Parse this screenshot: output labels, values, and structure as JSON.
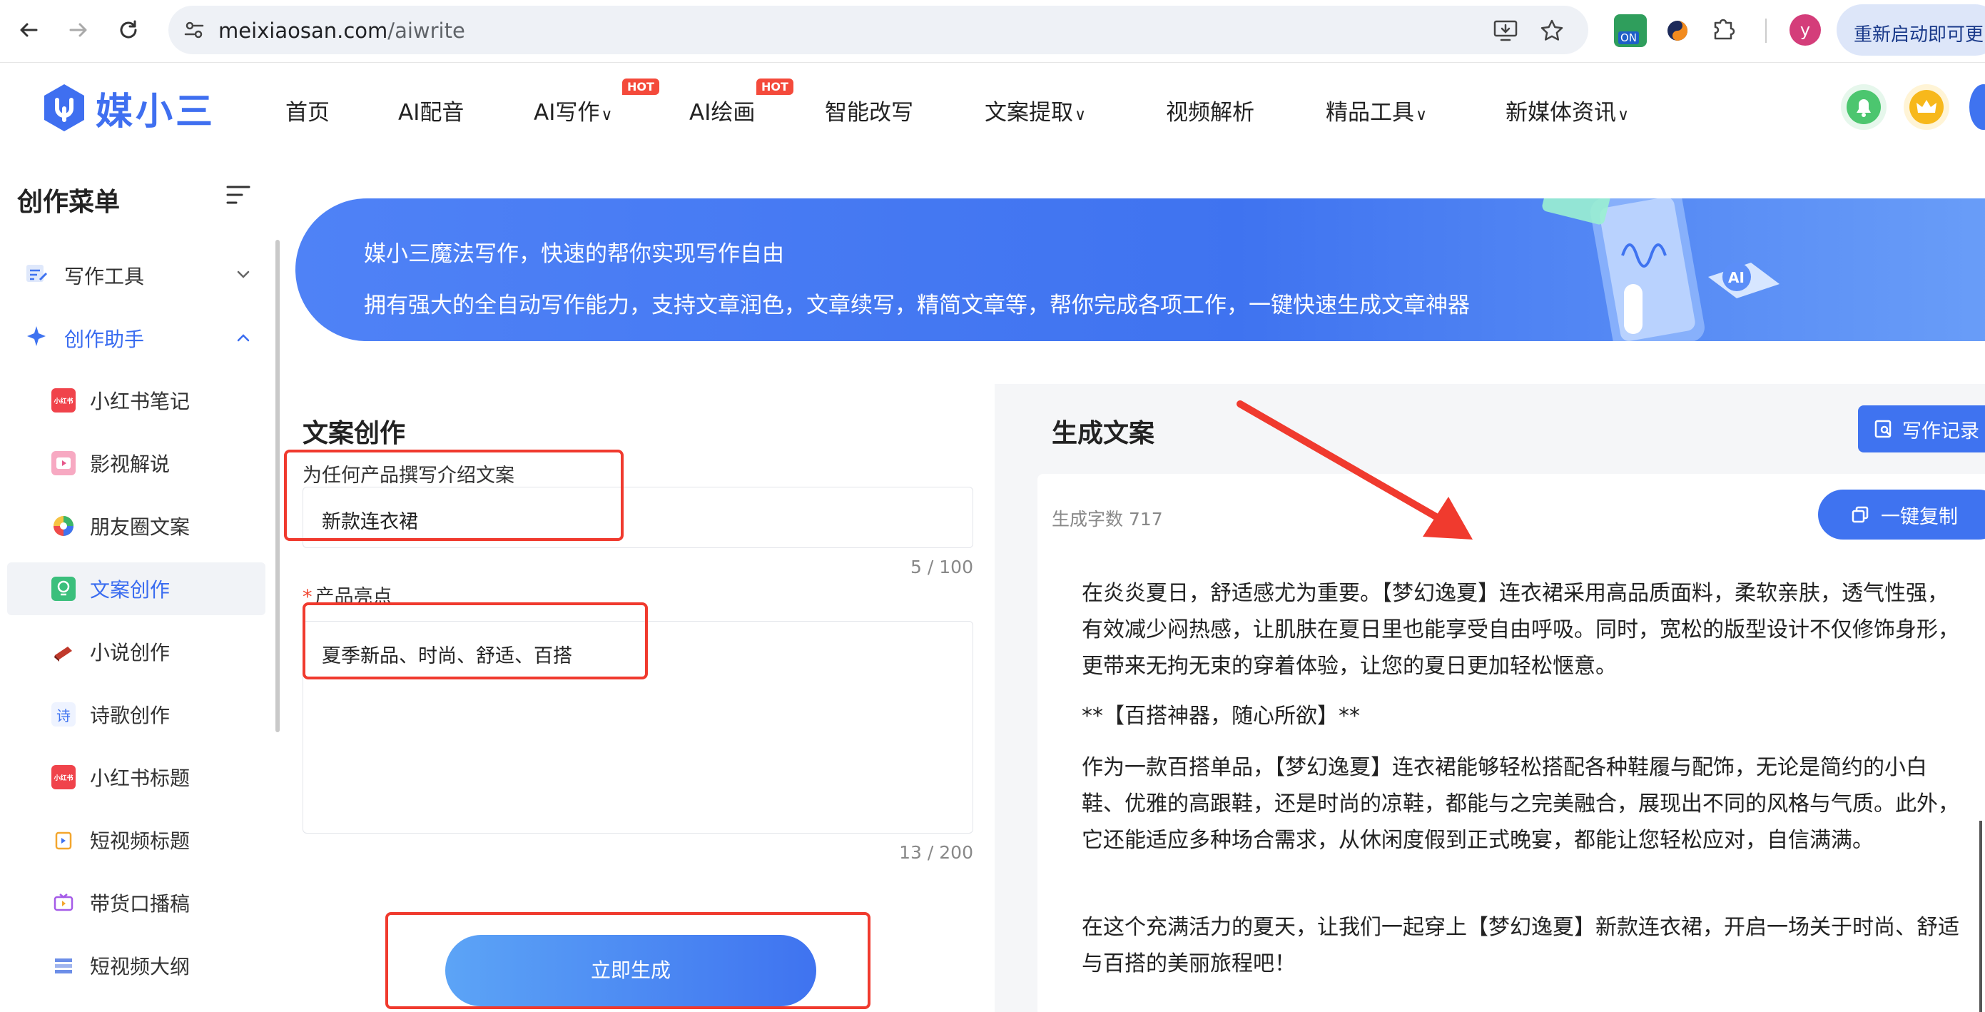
{
  "browser": {
    "url_host": "meixiaosan.com",
    "url_path": "/aiwrite",
    "profile_initial": "y",
    "relaunch_label": "重新启动即可更",
    "extension_badge": "ON"
  },
  "site": {
    "logo_text": "媒小三",
    "nav": [
      {
        "label": "首页"
      },
      {
        "label": "AI配音"
      },
      {
        "label": "AI写作",
        "dropdown": true,
        "badge": "HOT"
      },
      {
        "label": "AI绘画",
        "badge": "HOT"
      },
      {
        "label": "智能改写"
      },
      {
        "label": "文案提取",
        "dropdown": true
      },
      {
        "label": "视频解析"
      },
      {
        "label": "精品工具",
        "dropdown": true
      },
      {
        "label": "新媒体资讯",
        "dropdown": true
      }
    ],
    "caret": "∨",
    "hot_label": "HOT"
  },
  "sidebar": {
    "title": "创作菜单",
    "groups": [
      {
        "label": "写作工具",
        "expanded": false
      },
      {
        "label": "创作助手",
        "expanded": true
      }
    ],
    "items": [
      {
        "label": "小红书笔记",
        "icon": "xiaohongshu-icon",
        "icon_text": "小红书"
      },
      {
        "label": "影视解说",
        "icon": "video-icon"
      },
      {
        "label": "朋友圈文案",
        "icon": "moments-icon"
      },
      {
        "label": "文案创作",
        "icon": "lightbulb-icon",
        "active": true
      },
      {
        "label": "小说创作",
        "icon": "book-icon"
      },
      {
        "label": "诗歌创作",
        "icon": "poem-icon",
        "icon_text": "诗"
      },
      {
        "label": "小红书标题",
        "icon": "xiaohongshu-icon",
        "icon_text": "小红书"
      },
      {
        "label": "短视频标题",
        "icon": "short-video-icon"
      },
      {
        "label": "带货口播稿",
        "icon": "live-sale-icon"
      },
      {
        "label": "短视频大纲",
        "icon": "outline-icon"
      }
    ]
  },
  "banner": {
    "line1": "媒小三魔法写作，快速的帮你实现写作自由",
    "line2": "拥有强大的全自动写作能力，支持文章润色，文章续写，精简文章等，帮你完成各项工作，一键快速生成文章神器",
    "art_badge": "AI"
  },
  "form": {
    "title": "文案创作",
    "product_label": "为任何产品撰写介绍文案",
    "product_value": "新款连衣裙",
    "product_counter": "5 / 100",
    "highlights_required_mark": "*",
    "highlights_label": "产品亮点",
    "highlights_value": "夏季新品、时尚、舒适、百搭",
    "highlights_counter": "13 / 200",
    "generate_label": "立即生成"
  },
  "output": {
    "title": "生成文案",
    "record_label": "写作记录",
    "word_count": "生成字数 717",
    "copy_label": "一键复制",
    "paragraphs": [
      "在炎炎夏日，舒适感尤为重要。【梦幻逸夏】连衣裙采用高品质面料，柔软亲肤，透气性强，有效减少闷热感，让肌肤在夏日里也能享受自由呼吸。同时，宽松的版型设计不仅修饰身形，更带来无拘无束的穿着体验，让您的夏日更加轻松惬意。",
      "**【百搭神器，随心所欲】**",
      "作为一款百搭单品，【梦幻逸夏】连衣裙能够轻松搭配各种鞋履与配饰，无论是简约的小白鞋、优雅的高跟鞋，还是时尚的凉鞋，都能与之完美融合，展现出不同的风格与气质。此外，它还能适应多种场合需求，从休闲度假到正式晚宴，都能让您轻松应对，自信满满。",
      "在这个充满活力的夏天，让我们一起穿上【梦幻逸夏】新款连衣裙，开启一场关于时尚、舒适与百搭的美丽旅程吧！"
    ]
  },
  "colors": {
    "accent": "#3f73f0",
    "annotation_red": "#f03a2e",
    "hot_badge": "#f44a3b"
  }
}
